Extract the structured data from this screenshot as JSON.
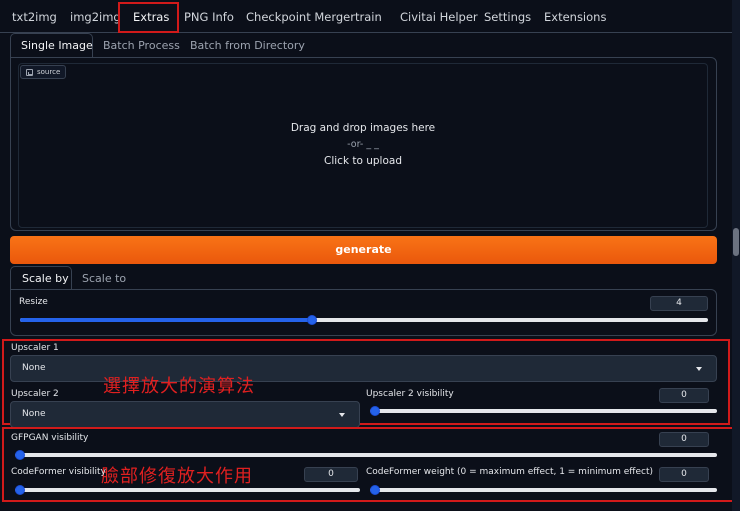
{
  "top_tabs": [
    "txt2img",
    "img2img",
    "Extras",
    "PNG Info",
    "Checkpoint Merger",
    "train",
    "Civitai Helper",
    "Settings",
    "Extensions"
  ],
  "sub_tabs": [
    "Single Image",
    "Batch Process",
    "Batch from Directory"
  ],
  "source": {
    "label": "source",
    "drop_text": "Drag and drop images here",
    "or_text": "-or- _ _",
    "click_text": "Click to upload"
  },
  "generate_label": "generate",
  "scale_tabs": [
    "Scale by",
    "Scale to"
  ],
  "resize": {
    "label": "Resize",
    "value": "4",
    "fraction": 0.425
  },
  "upscaler1": {
    "label": "Upscaler 1",
    "value": "None"
  },
  "upscaler2": {
    "label": "Upscaler 2",
    "value": "None"
  },
  "upscaler2_visibility": {
    "label": "Upscaler 2 visibility",
    "value": "0",
    "fraction": 0
  },
  "gfpgan": {
    "label": "GFPGAN visibility",
    "value": "0",
    "fraction": 0
  },
  "codeformer": {
    "label": "CodeFormer visibility",
    "value": "0",
    "fraction": 0
  },
  "codeformer_weight": {
    "label": "CodeFormer weight (0 = maximum effect, 1 = minimum effect)",
    "value": "0",
    "fraction": 0
  },
  "annotations": {
    "upscaler_note": "選擇放大的演算法",
    "face_note": "臉部修復放大作用"
  },
  "colors": {
    "accent": "#f97316",
    "slider": "#2563eb",
    "highlight": "#d11a1a"
  }
}
